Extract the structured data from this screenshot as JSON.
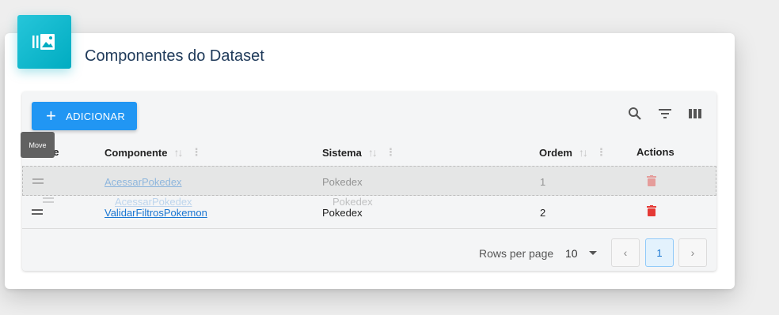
{
  "card": {
    "title": "Componentes do Dataset",
    "icon": "image-gallery-icon"
  },
  "toolbar": {
    "add_label": "ADICIONAR",
    "icons": [
      "search-icon",
      "filter-icon",
      "columns-icon"
    ]
  },
  "tooltip": {
    "text": "Move"
  },
  "columns": [
    {
      "label": "Componente"
    },
    {
      "label": "Sistema"
    },
    {
      "label": "Ordem"
    },
    {
      "label": "Actions"
    }
  ],
  "column_partial": "ve",
  "rows": [
    {
      "componente": "AcessarPokedex",
      "sistema": "Pokedex",
      "ordem": "1"
    },
    {
      "componente": "ValidarFiltrosPokemon",
      "sistema": "Pokedex",
      "ordem": "2"
    }
  ],
  "drag_ghost": {
    "componente": "AcessarPokedex",
    "sistema": "Pokedex"
  },
  "pagination": {
    "rows_per_page_label": "Rows per page",
    "rows_per_page_value": "10",
    "current_page": "1",
    "prev_icon": "chevron-left-icon",
    "next_icon": "chevron-right-icon"
  },
  "colors": {
    "primary": "#2196f3",
    "accent": "#00acc1",
    "danger": "#e53935",
    "link": "#1976d2"
  }
}
